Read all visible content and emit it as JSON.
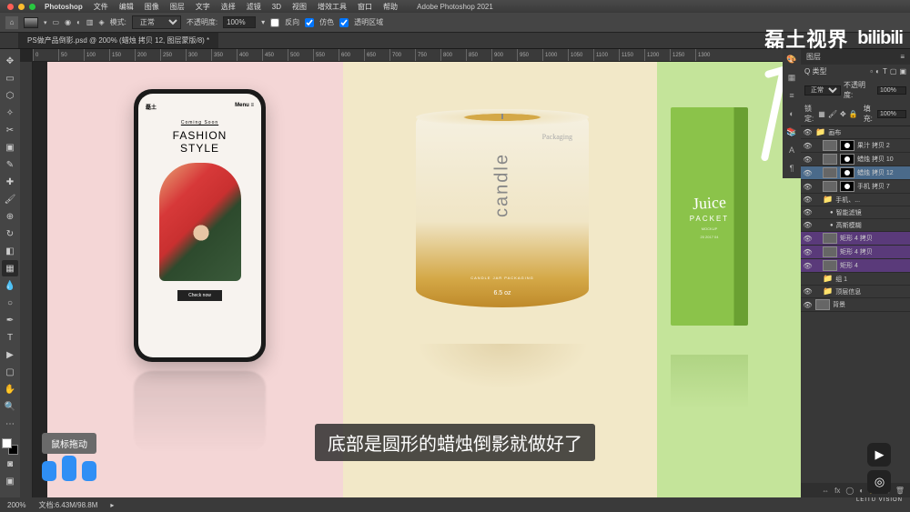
{
  "app_title": "Adobe Photoshop 2021",
  "menu": [
    "Photoshop",
    "文件",
    "编辑",
    "图像",
    "图层",
    "文字",
    "选择",
    "滤镜",
    "3D",
    "视图",
    "增效工具",
    "窗口",
    "帮助"
  ],
  "options_bar": {
    "mode_label": "模式:",
    "mode_value": "正常",
    "opacity_label": "不透明度:",
    "opacity_value": "100%",
    "reverse": "反向",
    "dither": "仿色",
    "transparency": "透明区域"
  },
  "document_tab": "PS做产品倒影.psd @ 200% (蜡烛 拷贝 12, 图层蒙版/8) *",
  "ruler_marks": [
    "0",
    "50",
    "100",
    "150",
    "200",
    "250",
    "300",
    "350",
    "400",
    "450",
    "500",
    "550",
    "600",
    "650",
    "700",
    "750",
    "800",
    "850",
    "900",
    "950",
    "1000",
    "1050",
    "1100",
    "1150",
    "1200",
    "1250",
    "1300"
  ],
  "phone": {
    "brand": "磊土",
    "menu": "Menu ≡",
    "coming": "Coming Soon",
    "title_line1": "FASHION",
    "title_line2": "STYLE",
    "button": "Check now"
  },
  "candle": {
    "text": "candle",
    "tag": "Packaging",
    "label": "CANDLE JAR PACKAGING",
    "size": "6.5 oz"
  },
  "juice": {
    "logo": "Juice",
    "sub": "PACKET",
    "mockup": "MOCKUP",
    "code": "20 2017 04"
  },
  "panels": {
    "layers_tab": "图层",
    "kind_label": "Q 类型",
    "blend_mode": "正常",
    "opacity_label": "不透明度:",
    "opacity_value": "100%",
    "lock_label": "锁定:",
    "fill_label": "填充:",
    "fill_value": "100%"
  },
  "layers": [
    {
      "name": "画布",
      "visible": true,
      "type": "group",
      "indent": 0
    },
    {
      "name": "果汁 拷贝 2",
      "visible": true,
      "type": "layer",
      "indent": 1,
      "mask": true
    },
    {
      "name": "蜡烛 拷贝 10",
      "visible": true,
      "type": "layer",
      "indent": 1,
      "mask": true
    },
    {
      "name": "蜡烛 拷贝 12",
      "visible": true,
      "type": "layer",
      "indent": 1,
      "mask": true,
      "selected": true
    },
    {
      "name": "手机 拷贝 7",
      "visible": true,
      "type": "layer",
      "indent": 1,
      "mask": true
    },
    {
      "name": "手机、...",
      "visible": true,
      "type": "group",
      "indent": 1
    },
    {
      "name": "智能滤镜",
      "visible": true,
      "type": "fx",
      "indent": 2
    },
    {
      "name": "高斯模糊",
      "visible": true,
      "type": "fx",
      "indent": 2
    },
    {
      "name": "矩形 4 拷贝",
      "visible": true,
      "type": "shape",
      "indent": 1,
      "purple": true
    },
    {
      "name": "矩形 4 拷贝",
      "visible": true,
      "type": "shape",
      "indent": 1,
      "purple": true
    },
    {
      "name": "矩形 4",
      "visible": true,
      "type": "shape",
      "indent": 1,
      "purple": true
    },
    {
      "name": "组 1",
      "visible": false,
      "type": "group",
      "indent": 1
    },
    {
      "name": "顶层信息",
      "visible": true,
      "type": "group",
      "indent": 1
    },
    {
      "name": "背景",
      "visible": true,
      "type": "bg",
      "indent": 0
    }
  ],
  "status": {
    "zoom": "200%",
    "doc_info": "文档:6.43M/98.8M"
  },
  "overlay": {
    "watermark1": "磊土视界",
    "watermark2": "bilibili",
    "subtitle": "底部是圆形的蜡烛倒影就做好了",
    "hint": "鼠标拖动",
    "brand_label": "LEITU VISION"
  }
}
